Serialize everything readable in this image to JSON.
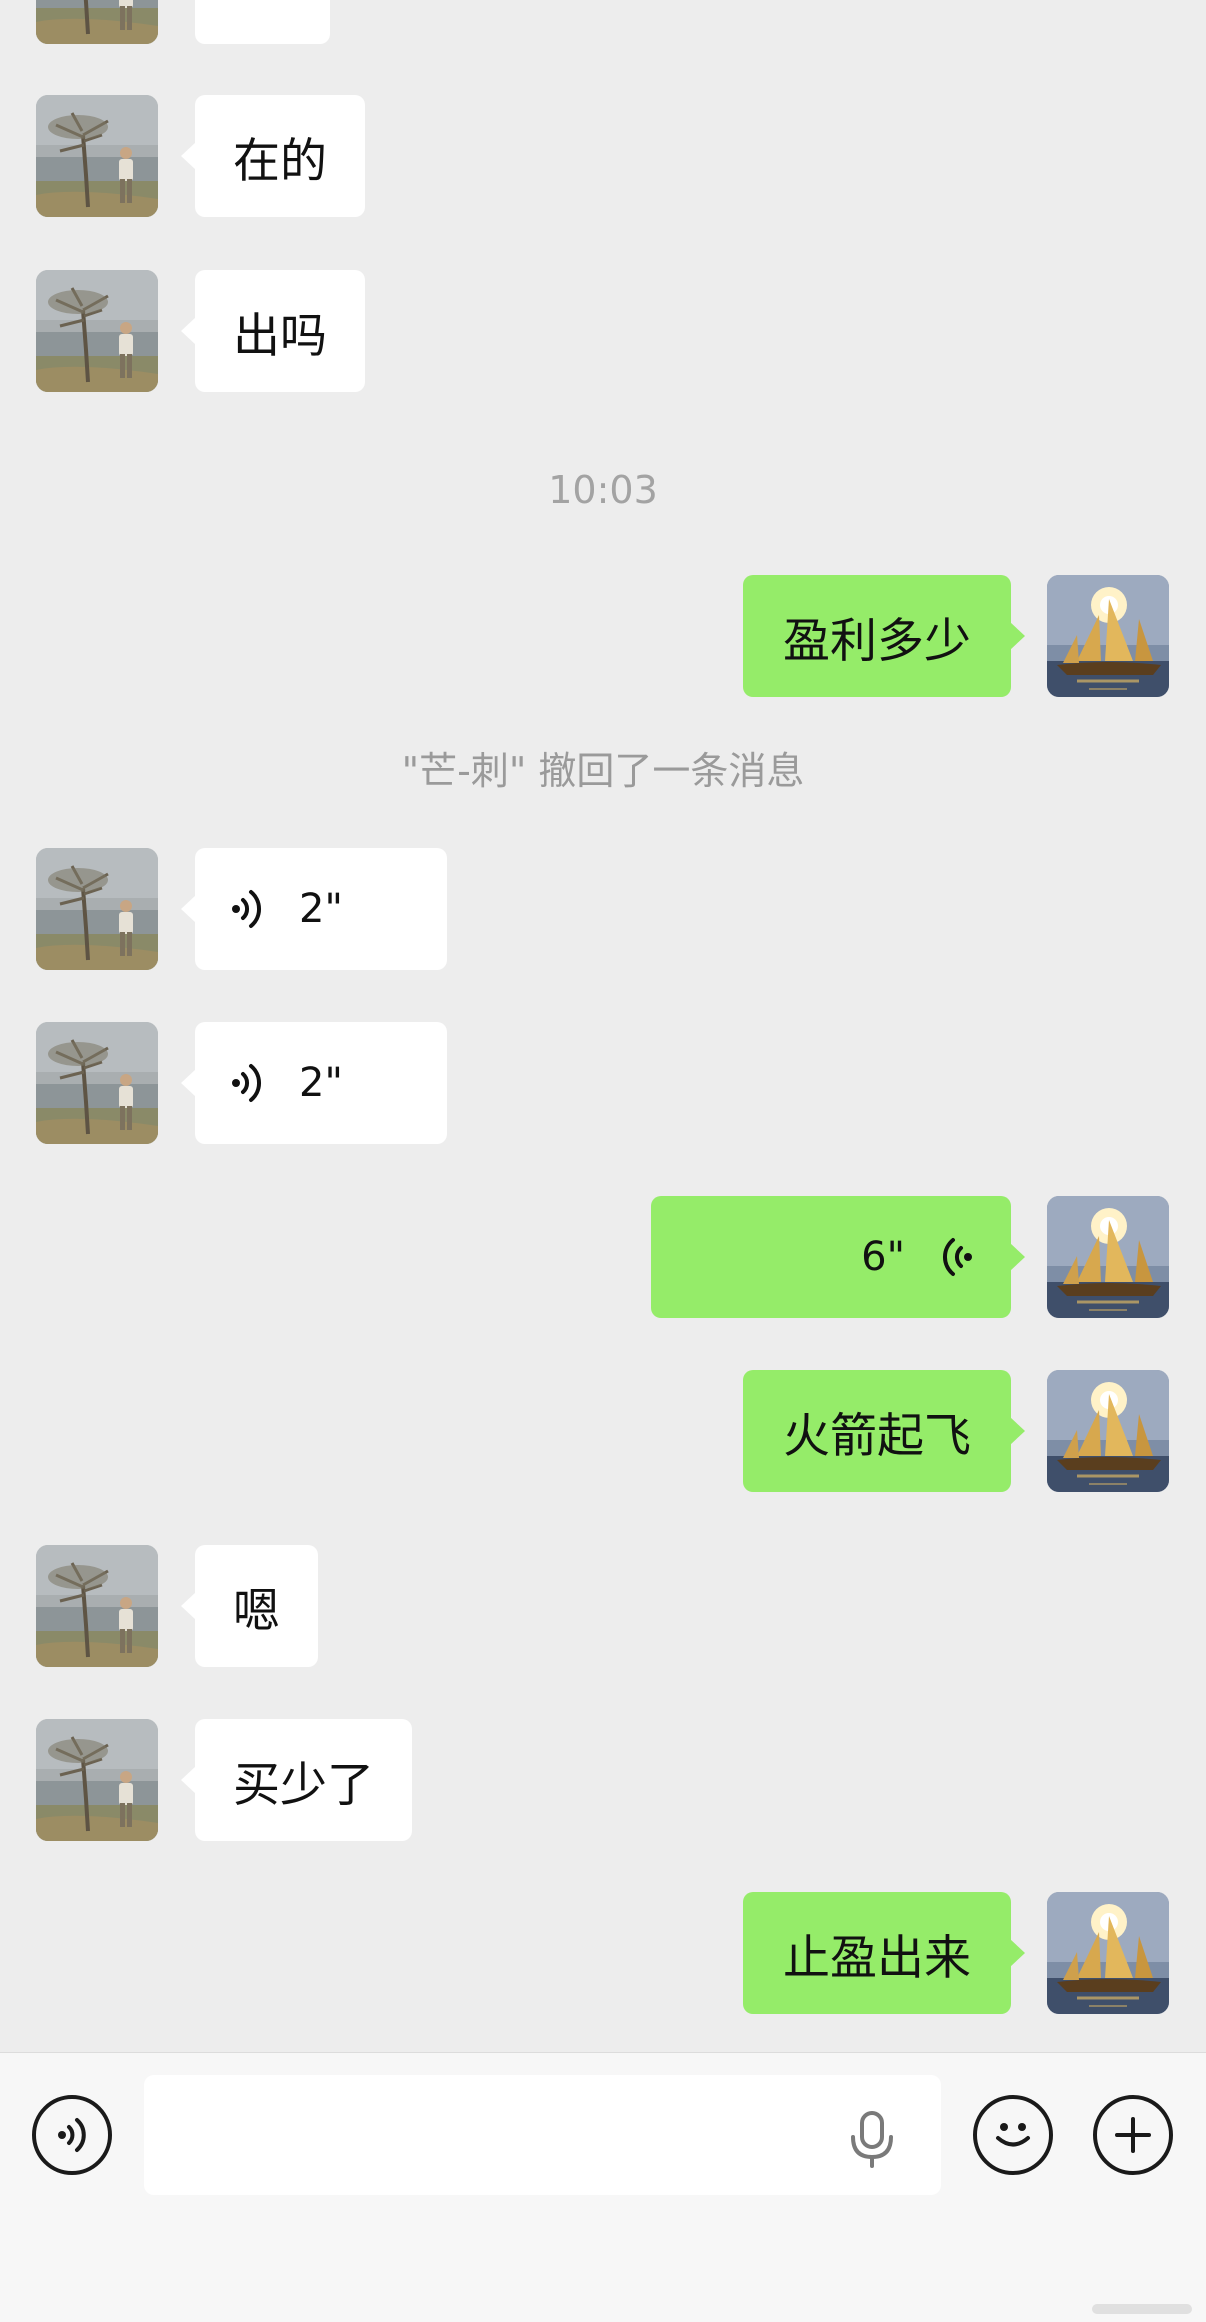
{
  "contacts": {
    "other": {
      "avatar_icon": "man-under-tree-photo"
    },
    "me": {
      "avatar_icon": "sailing-ship-photo"
    }
  },
  "messages": [
    {
      "type": "text",
      "direction": "in",
      "text": "在的"
    },
    {
      "type": "text",
      "direction": "in",
      "text": "出吗"
    },
    {
      "type": "timestamp",
      "text": "10:03"
    },
    {
      "type": "text",
      "direction": "out",
      "text": "盈利多少"
    },
    {
      "type": "system",
      "text": "\"芒-刺\" 撤回了一条消息"
    },
    {
      "type": "voice",
      "direction": "in",
      "duration": "2\""
    },
    {
      "type": "voice",
      "direction": "in",
      "duration": "2\""
    },
    {
      "type": "voice",
      "direction": "out",
      "duration": "6\""
    },
    {
      "type": "text",
      "direction": "out",
      "text": "火箭起飞"
    },
    {
      "type": "text",
      "direction": "in",
      "text": "嗯"
    },
    {
      "type": "text",
      "direction": "in",
      "text": "买少了"
    },
    {
      "type": "text",
      "direction": "out",
      "text": "止盈出来"
    }
  ],
  "input_bar": {
    "voice_toggle_icon": "voice-mode-icon",
    "text_value": "",
    "mic_icon": "microphone-icon",
    "emoji_icon": "emoji-icon",
    "more_icon": "plus-icon"
  },
  "colors": {
    "background": "#ededed",
    "incoming_bubble": "#ffffff",
    "outgoing_bubble": "#95ec69",
    "meta_text": "#a3a3a3"
  }
}
